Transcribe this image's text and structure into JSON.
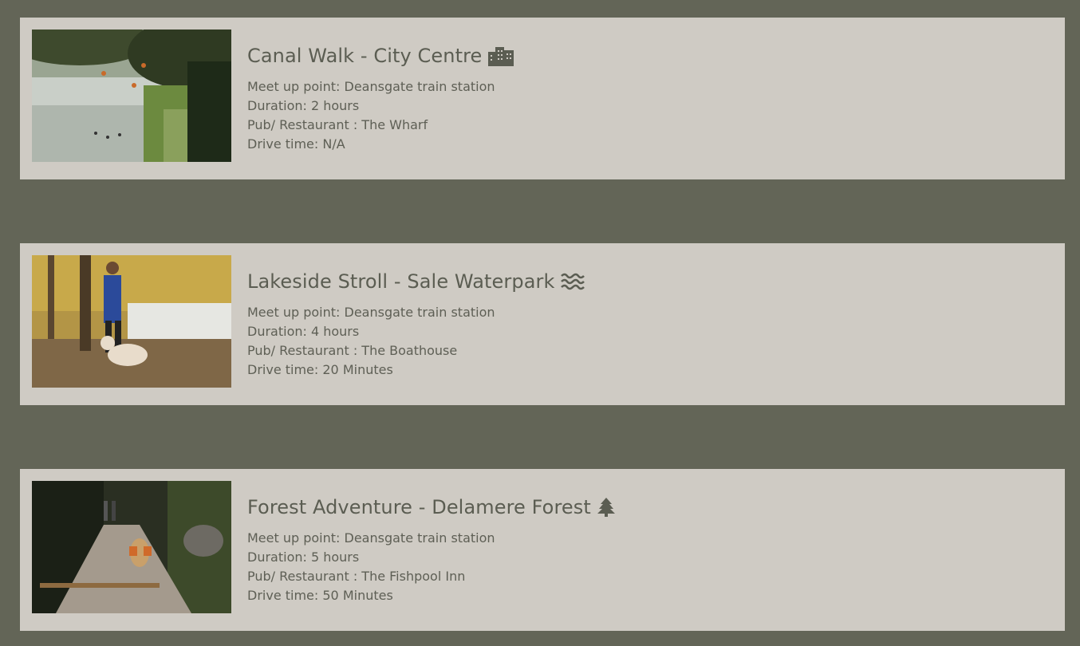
{
  "walks": [
    {
      "title": "Canal Walk - City Centre",
      "icon": "city-icon",
      "image": "canal-photo",
      "meet_up": "Meet up point: Deansgate train station",
      "duration": "Duration: 2 hours",
      "pub": "Pub/ Restaurant : The Wharf",
      "drive_time": "Drive time: N/A"
    },
    {
      "title": "Lakeside Stroll - Sale Waterpark",
      "icon": "water-icon",
      "image": "lakeside-photo",
      "meet_up": "Meet up point: Deansgate train station",
      "duration": "Duration: 4 hours",
      "pub": "Pub/ Restaurant : The Boathouse",
      "drive_time": "Drive time: 20 Minutes"
    },
    {
      "title": "Forest Adventure - Delamere Forest",
      "icon": "tree-icon",
      "image": "forest-photo",
      "meet_up": "Meet up point: Deansgate train station",
      "duration": "Duration: 5 hours",
      "pub": "Pub/ Restaurant : The Fishpool Inn",
      "drive_time": "Drive time: 50 Minutes"
    }
  ],
  "colors": {
    "page_background": "#636557",
    "card_background": "#cfcbc4",
    "text": "#5e5f55"
  }
}
